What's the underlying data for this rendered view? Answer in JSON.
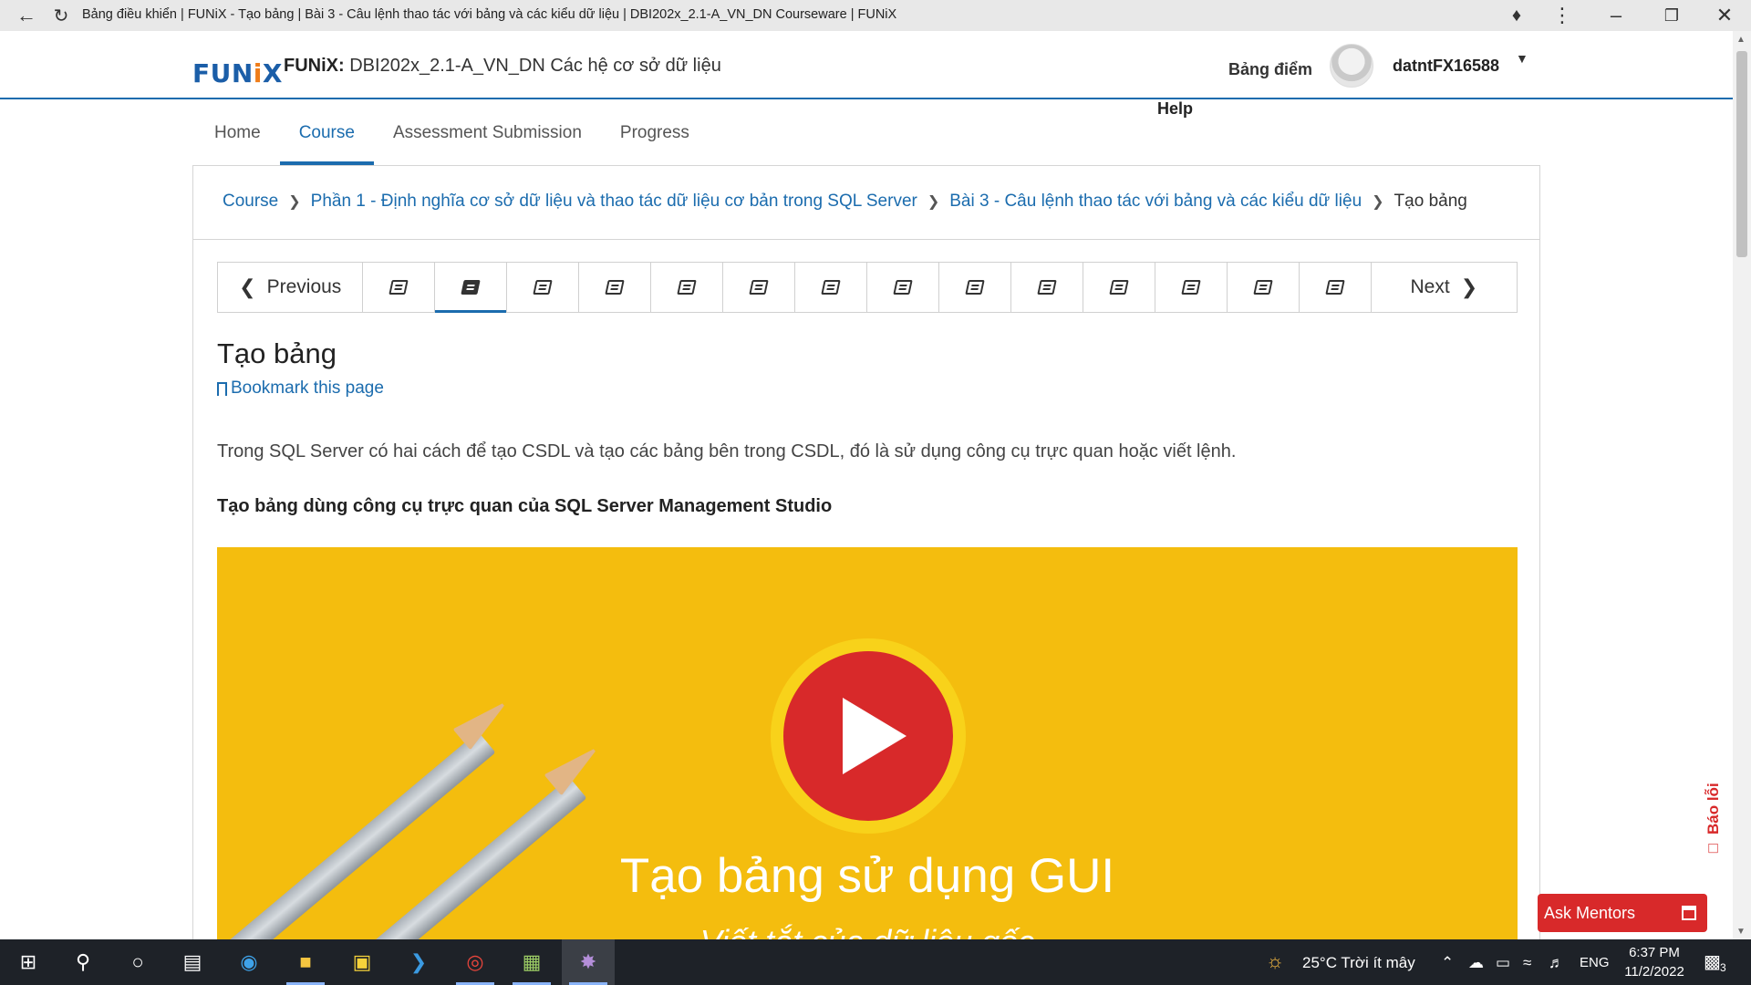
{
  "browser": {
    "title": "Bảng điều khiển | FUNiX - Tạo bảng | Bài 3 - Câu lệnh thao tác với bảng và các kiểu dữ liệu | DBI202x_2.1-A_VN_DN Courseware | FUNiX",
    "icons": [
      "back-arrow-icon",
      "reload-icon",
      "puzzle-icon",
      "kebab-menu-icon",
      "minimize-icon",
      "restore-icon",
      "close-icon"
    ]
  },
  "header": {
    "logo": "FUNiX",
    "org": "FUNiX:",
    "course": "DBI202x_2.1-A_VN_DN Các hệ cơ sở dữ liệu",
    "grades_label": "Bảng điểm",
    "username": "datntFX16588",
    "help_label": "Help"
  },
  "tabs": [
    {
      "label": "Home",
      "active": false
    },
    {
      "label": "Course",
      "active": true
    },
    {
      "label": "Assessment Submission",
      "active": false
    },
    {
      "label": "Progress",
      "active": false
    }
  ],
  "breadcrumb": [
    "Course",
    "Phần 1 - Định nghĩa cơ sở dữ liệu và thao tác dữ liệu cơ bản trong SQL Server",
    "Bài 3 - Câu lệnh thao tác với bảng và các kiểu dữ liệu",
    "Tạo bảng"
  ],
  "sequence": {
    "prev_label": "Previous",
    "next_label": "Next",
    "unit_count": 14,
    "active_index": 1
  },
  "unit": {
    "title": "Tạo bảng",
    "bookmark_label": "Bookmark this page",
    "intro": "Trong SQL Server có hai cách để tạo CSDL và tạo các bảng bên trong CSDL, đó là sử dụng công cụ trực quan hoặc viết lệnh.",
    "heading": "Tạo bảng dùng công cụ trực quan của SQL Server Management Studio"
  },
  "video": {
    "title": "Tạo bảng sử dụng GUI",
    "subtitle": "Viết tắt của dữ liệu gốc",
    "background": "#f4bd0e",
    "play_color": "#d8292a"
  },
  "widgets": {
    "report_label": "Báo lỗi",
    "ask_mentors_label": "Ask Mentors"
  },
  "taskbar": {
    "weather": "25°C  Trời ít mây",
    "language": "ENG",
    "time": "6:37 PM",
    "date": "11/2/2022",
    "notifications": "3"
  },
  "colors": {
    "accent": "#1b6cae",
    "brand_orange": "#ef7d1a",
    "alert_red": "#d8292a"
  }
}
